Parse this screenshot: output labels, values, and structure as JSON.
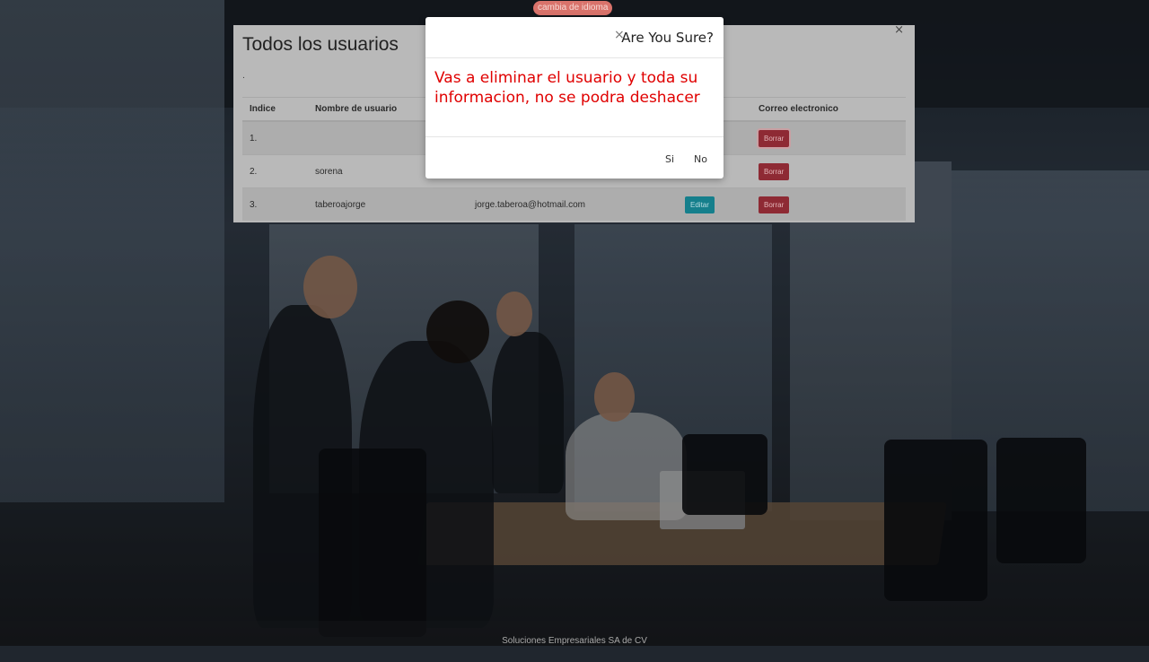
{
  "language_button": "cambia de idioma",
  "panel": {
    "title": "Todos los usuarios",
    "subtitle": ".",
    "close": "×",
    "columns": [
      "Indice",
      "Nombre de usuario",
      "",
      "",
      "Correo electronico"
    ],
    "rows": [
      {
        "index": "1.",
        "username": "",
        "email": "",
        "edit": "",
        "delete": "Borrar"
      },
      {
        "index": "2.",
        "username": "sorena",
        "email": "",
        "edit": "",
        "delete": "Borrar"
      },
      {
        "index": "3.",
        "username": "taberoajorge",
        "email": "jorge.taberoa@hotmail.com",
        "edit": "Editar",
        "delete": "Borrar"
      }
    ]
  },
  "modal": {
    "close": "×",
    "title": "Are You Sure?",
    "message": "Vas a eliminar el usuario y toda su informacion, no se podra deshacer",
    "confirm": "Si",
    "cancel": "No"
  },
  "footer": "Soluciones Empresariales SA de CV",
  "colors": {
    "danger": "#dc3545",
    "info": "#17a2b8",
    "message": "#e00000"
  }
}
